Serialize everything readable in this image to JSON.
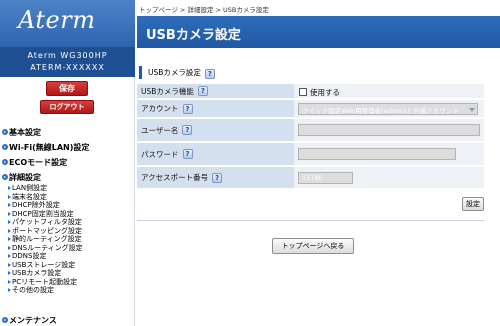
{
  "sidebar": {
    "logo": "Aterm",
    "model": "Aterm WG300HP",
    "serial": "ATERM-XXXXXX",
    "save_label": "保存",
    "logout_label": "ログアウト",
    "nav": [
      {
        "label": "基本設定",
        "items": []
      },
      {
        "label": "Wi-Fi(無線LAN)設定",
        "items": []
      },
      {
        "label": "ECOモード設定",
        "items": []
      },
      {
        "label": "詳細設定",
        "items": [
          "LAN側設定",
          "端末名設定",
          "DHCP除外設定",
          "DHCP固定割当設定",
          "パケットフィルタ設定",
          "ポートマッピング設定",
          "静的ルーティング設定",
          "DNSルーティング設定",
          "DDNS設定",
          "USBストレージ設定",
          "USBカメラ設定",
          "PCリモート起動設定",
          "その他の設定"
        ]
      },
      {
        "label": "メンテナンス",
        "items": []
      }
    ]
  },
  "breadcrumb": "トップページ > 詳細設定 > USBカメラ設定",
  "page_title": "USBカメラ設定",
  "section_title": "USBカメラ設定",
  "help_icon_label": "?",
  "form": {
    "rows": [
      {
        "label": "USBカメラ機能",
        "type": "checkbox",
        "checked": false,
        "option": "使用する"
      },
      {
        "label": "アカウント",
        "type": "select",
        "value": "クイック設定Web用管理者(admin)と共通アカウント"
      },
      {
        "label": "ユーザー名",
        "type": "text",
        "value": ""
      },
      {
        "label": "パスワード",
        "type": "password",
        "value": ""
      },
      {
        "label": "アクセスポート番号",
        "type": "text",
        "value": "15790"
      }
    ]
  },
  "set_button_label": "設定",
  "top_button_label": "トップページへ戻る",
  "colors": {
    "title_bar": "#2563ae",
    "label_bg": "#d5e0ee",
    "value_bg": "#eef2f7",
    "save_button": "#c42828"
  }
}
